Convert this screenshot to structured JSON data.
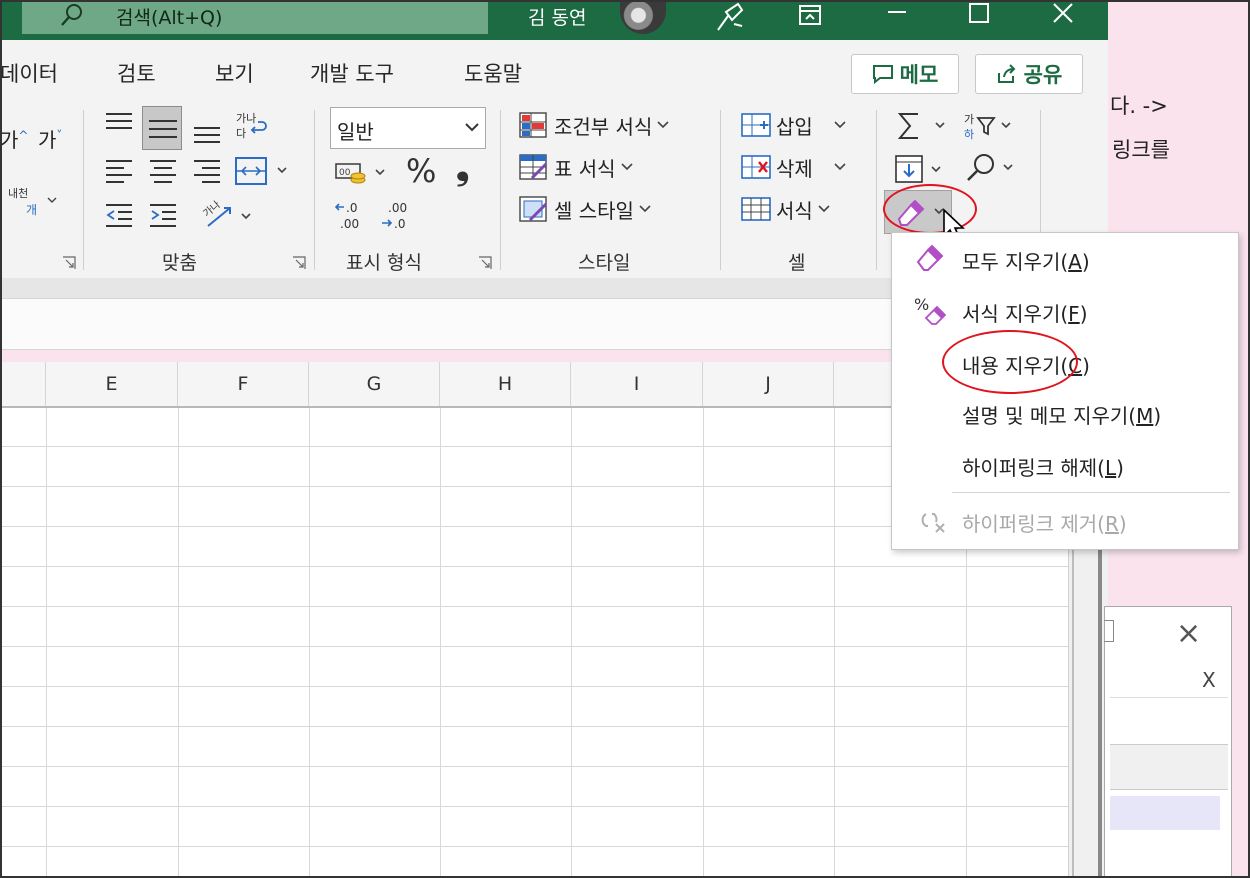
{
  "titlebar": {
    "search_placeholder": "검색(Alt+Q)",
    "user_name": "김 동연"
  },
  "ribbon": {
    "tabs": [
      "데이터",
      "검토",
      "보기",
      "개발 도구",
      "도움말"
    ],
    "memo_label": "메모",
    "share_label": "공유",
    "font_buttons": [
      "가",
      "가"
    ],
    "wrap_text_label": "가나\n다",
    "number_format_value": "일반",
    "styles": {
      "conditional_label": "조건부 서식",
      "table_label": "표 서식",
      "cell_style_label": "셀 스타일"
    },
    "cells": {
      "insert_label": "삽입",
      "delete_label": "삭제",
      "format_label": "서식"
    },
    "group_labels": {
      "alignment": "맞춤",
      "number": "표시 형식",
      "styles": "스타일",
      "cells": "셀"
    },
    "percent": "%",
    "comma": "❟"
  },
  "grid": {
    "columns": [
      "E",
      "F",
      "G",
      "H",
      "I",
      "J"
    ]
  },
  "background_doc": {
    "line1": "다. ->",
    "line2": "링크를",
    "dialog_close": "×",
    "dialog_x": "X"
  },
  "clear_menu": {
    "items": [
      {
        "label": "모두 지우기",
        "key": "A",
        "icon": "eraser-icon",
        "enabled": true
      },
      {
        "label": "서식 지우기",
        "key": "F",
        "icon": "clear-format-icon",
        "enabled": true
      },
      {
        "label": "내용 지우기",
        "key": "C",
        "icon": "",
        "enabled": true
      },
      {
        "label": "설명 및 메모 지우기",
        "key": "M",
        "icon": "",
        "enabled": true
      },
      {
        "label": "하이퍼링크 해제",
        "key": "L",
        "icon": "",
        "enabled": true
      },
      {
        "label": "하이퍼링크 제거",
        "key": "R",
        "icon": "remove-link-icon",
        "enabled": false
      }
    ]
  },
  "colors": {
    "title_green": "#1d6b43",
    "accent_red": "#e0141f",
    "eraser_purple": "#b24fc7"
  }
}
